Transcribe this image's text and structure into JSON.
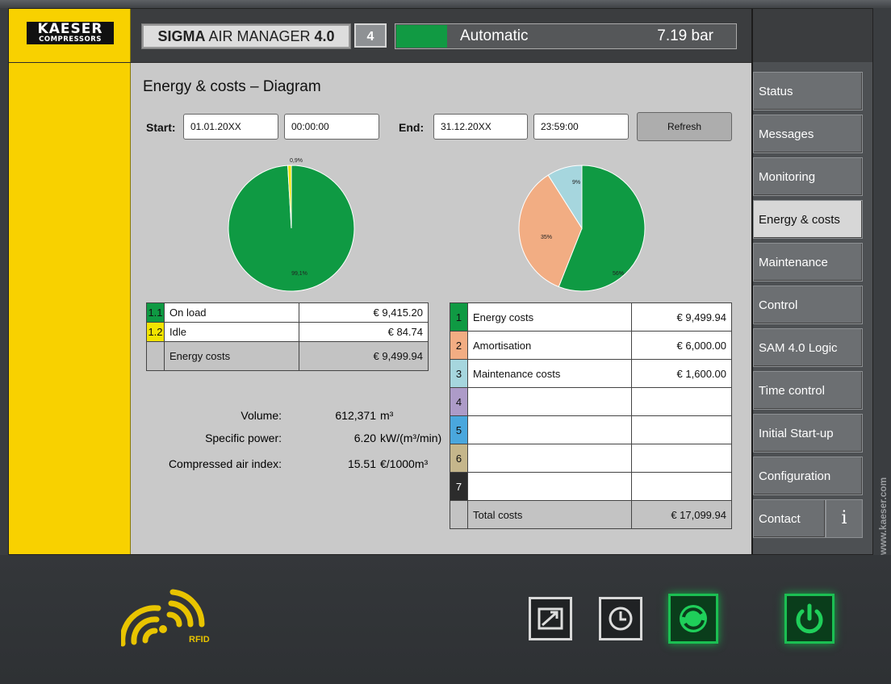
{
  "brand": {
    "line1": "KAESER",
    "line2": "COMPRESSORS"
  },
  "header": {
    "title_bold": "SIGMA",
    "title_rest": " AIR MANAGER ",
    "title_version": "4.0",
    "station_number": "4",
    "mode": "Automatic",
    "pressure": "7.19 bar",
    "status_color": "#119a43"
  },
  "nav": {
    "items": [
      {
        "label": "Status"
      },
      {
        "label": "Messages"
      },
      {
        "label": "Monitoring"
      },
      {
        "label": "Energy & costs",
        "active": true
      },
      {
        "label": "Maintenance"
      },
      {
        "label": "Control"
      },
      {
        "label": "SAM 4.0 Logic"
      },
      {
        "label": "Time control"
      },
      {
        "label": "Initial Start-up"
      },
      {
        "label": "Configuration"
      },
      {
        "label": "Contact"
      }
    ],
    "info_label": "i"
  },
  "page": {
    "title": "Energy & costs – Diagram",
    "start_label": "Start:",
    "start_date": "01.01.20XX",
    "start_time": "00:00:00",
    "end_label": "End:",
    "end_date": "31.12.20XX",
    "end_time": "23:59:00",
    "refresh_label": "Refresh"
  },
  "energy_table": {
    "rows": [
      {
        "num": "1.1",
        "label": "On load",
        "value": "€ 9,415.20",
        "color": "#0f9a43"
      },
      {
        "num": "1.2",
        "label": "Idle",
        "value": "€ 84.74",
        "color": "#f2e400"
      }
    ],
    "total": {
      "label": "Energy costs",
      "value": "€ 9,499.94"
    }
  },
  "cost_table": {
    "rows": [
      {
        "num": "1",
        "label": "Energy costs",
        "value": "€ 9,499.94",
        "color": "#0f9a43"
      },
      {
        "num": "2",
        "label": "Amortisation",
        "value": "€ 6,000.00",
        "color": "#f2ad83"
      },
      {
        "num": "3",
        "label": "Maintenance costs",
        "value": "€ 1,600.00",
        "color": "#a6d6de"
      },
      {
        "num": "4",
        "label": "",
        "value": "",
        "color": "#ad9bc8"
      },
      {
        "num": "5",
        "label": "",
        "value": "",
        "color": "#4aa7dd"
      },
      {
        "num": "6",
        "label": "",
        "value": "",
        "color": "#c5b68b"
      },
      {
        "num": "7",
        "label": "",
        "value": "",
        "color": "#2c2c2c"
      }
    ],
    "total": {
      "label": "Total costs",
      "value": "€ 17,099.94"
    }
  },
  "stats": {
    "volume_label": "Volume:",
    "volume_value": "612,371",
    "volume_unit": "m³",
    "specific_power_label": "Specific power:",
    "specific_power_value": "6.20",
    "specific_power_unit": "kW/(m³/min)",
    "air_index_label": "Compressed air index:",
    "air_index_value": "15.51",
    "air_index_unit": "€/1000m³"
  },
  "chart_data": [
    {
      "type": "pie",
      "slices": [
        {
          "label": "99,1%",
          "value": 99.1,
          "color": "#0f9a43"
        },
        {
          "label": "0,9%",
          "value": 0.9,
          "color": "#f2e400"
        }
      ]
    },
    {
      "type": "pie",
      "slices": [
        {
          "label": "56%",
          "value": 56,
          "color": "#0f9a43"
        },
        {
          "label": "35%",
          "value": 35,
          "color": "#f2ad83"
        },
        {
          "label": "9%",
          "value": 9,
          "color": "#a6d6de"
        }
      ]
    }
  ],
  "bottom": {
    "rfid_label": "RFID",
    "website": "www.kaeser.com"
  }
}
